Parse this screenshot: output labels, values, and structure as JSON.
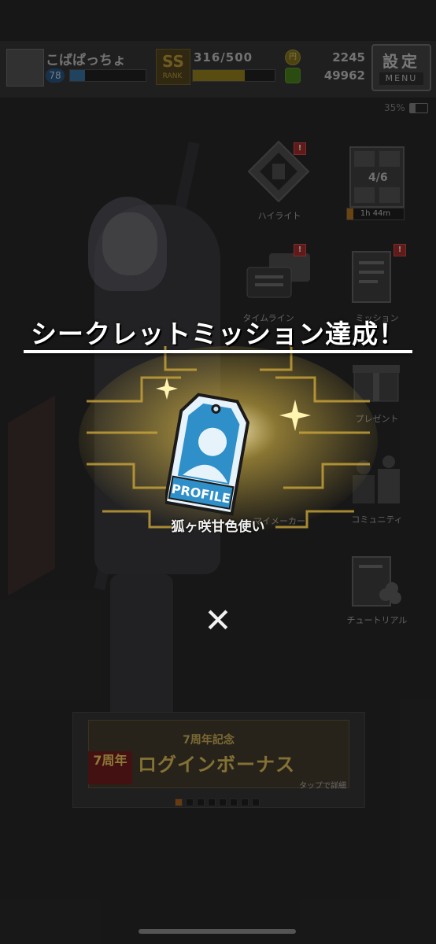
{
  "player": {
    "name": "こばぱっちょ",
    "level": "78",
    "exp_fill": 0.2
  },
  "rank": {
    "badge": "SS",
    "label": "RANK",
    "stamina": "316/500",
    "stamina_fill": 0.63
  },
  "currency": {
    "coins": "2245",
    "money": "49962"
  },
  "menu_button": {
    "label": "設定",
    "sub": "MENU"
  },
  "status": {
    "battery": "35%",
    "battery_fill": 0.35
  },
  "side_menu": {
    "highlight": "ハイライト",
    "timeline": "タイムライン",
    "mission": "ミッション",
    "present": "プレゼント",
    "maker": "マイメーカー",
    "community": "コミュニティ",
    "tutorial": "チュートリアル",
    "timer": "1h 44m",
    "stage": "4/6",
    "notice": "!"
  },
  "banner": {
    "title": "7周年記念",
    "main": "ログインボーナス",
    "badge": "7周年",
    "hint": "タップで詳細",
    "dot_count": 8,
    "active_dot": 0
  },
  "reward": {
    "headline": "シークレットミッション達成！",
    "item_type": "PROFILE",
    "item_name": "狐ヶ咲甘色使い",
    "close": "✕"
  },
  "colors": {
    "gold": "#e7c34a",
    "tag_blue": "#2f8fc8",
    "tag_light": "#e7f3fb"
  }
}
